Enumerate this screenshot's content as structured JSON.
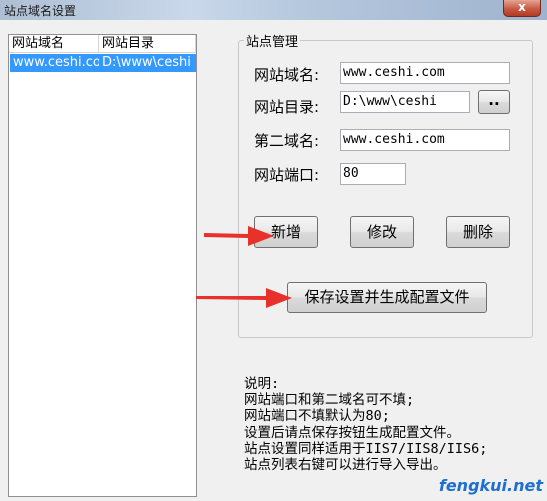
{
  "window": {
    "title": "站点域名设置",
    "close_glyph": "x"
  },
  "site_list": {
    "columns": [
      "网站域名",
      "网站目录"
    ],
    "rows": [
      {
        "domain": "www.ceshi.co",
        "dir": "D:\\www\\ceshi"
      }
    ]
  },
  "site_manager": {
    "group_title": "站点管理",
    "domain_label": "网站域名:",
    "domain_value": "www.ceshi.com",
    "dir_label": "网站目录:",
    "dir_value": "D:\\www\\ceshi",
    "browse_label": "..",
    "second_label": "第二域名:",
    "second_value": "www.ceshi.com",
    "port_label": "网站端口:",
    "port_value": "80",
    "add_label": "新增",
    "edit_label": "修改",
    "delete_label": "删除",
    "save_label": "保存设置并生成配置文件"
  },
  "notes": {
    "title": "说明:",
    "lines": [
      "网站端口和第二域名可不填;",
      "网站端口不填默认为80;",
      "设置后请点保存按钮生成配置文件。",
      "站点设置同样适用于IIS7/IIS8/IIS6;",
      "站点列表右键可以进行导入导出。"
    ]
  },
  "watermark": "fengkui.net",
  "colors": {
    "selection": "#3399ff",
    "arrow": "#e8312a",
    "watermark": "#1e6fd0"
  }
}
